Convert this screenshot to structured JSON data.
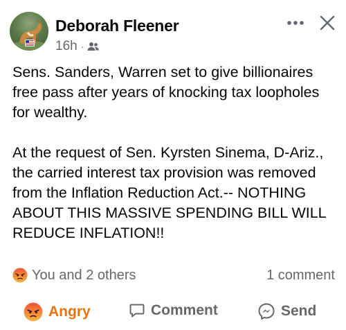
{
  "post": {
    "author": "Deborah Fleener",
    "time": "16h",
    "separator": "·",
    "audience_icon": "friends-icon",
    "header_icons": [
      "more-icon",
      "close-icon"
    ],
    "paragraphs": [
      "Sens. Sanders, Warren set to give billionaires free pass after years of knocking tax loopholes for wealthy.",
      "At the request of Sen. Kyrsten Sinema, D-Ariz., the carried interest tax provision was removed from the Inflation Reduction Act.-- NOTHING ABOUT THIS MASSIVE SPENDING BILL WILL REDUCE INFLATION!!"
    ]
  },
  "stats": {
    "reaction_icon": "angry-emoji",
    "reactions_text": "You and 2 others",
    "comments_text": "1 comment"
  },
  "actions": {
    "react_label": "Angry",
    "react_icon": "angry-emoji",
    "comment_label": "Comment",
    "comment_icon": "comment-bubble-icon",
    "send_label": "Send",
    "send_icon": "messenger-icon"
  },
  "colors": {
    "text": "#050505",
    "secondary": "#65676b",
    "angry": "#e9710f"
  }
}
